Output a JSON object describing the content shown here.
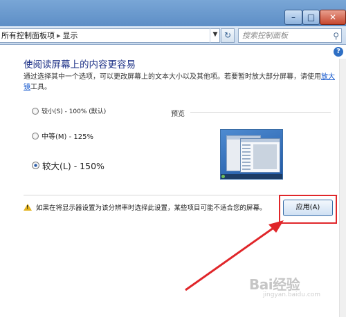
{
  "window": {
    "minimize_icon": "minimize-icon",
    "maximize_icon": "maximize-icon",
    "close_icon": "close-icon"
  },
  "address_bar": {
    "breadcrumb": [
      "所有控制面板项",
      "显示"
    ],
    "refresh_icon": "refresh-icon",
    "search_placeholder": "搜索控制面板"
  },
  "main": {
    "title": "使阅读屏幕上的内容更容易",
    "description_prefix": "通过选择其中一个选项，可以更改屏幕上的文本大小以及其他项。若要暂时放大部分屏幕，请使用",
    "description_link": "放大镜",
    "description_suffix": "工具。",
    "options": [
      {
        "label": "较小(S) - 100% (默认)",
        "checked": false
      },
      {
        "label": "中等(M) - 125%",
        "checked": false
      },
      {
        "label": "较大(L) - 150%",
        "checked": true
      }
    ],
    "preview_label": "预览",
    "warning_text": "如果在将显示器设置为该分辨率时选择此设置，某些项目可能不适合您的屏幕。",
    "apply_button": "应用(A)"
  },
  "watermark": {
    "logo": "Bai经验",
    "url": "jingyan.baidu.com"
  },
  "colors": {
    "title_text": "#1e3287",
    "link": "#1155cc",
    "annotation_red": "#e0262a",
    "warning": "#e3b21c"
  }
}
